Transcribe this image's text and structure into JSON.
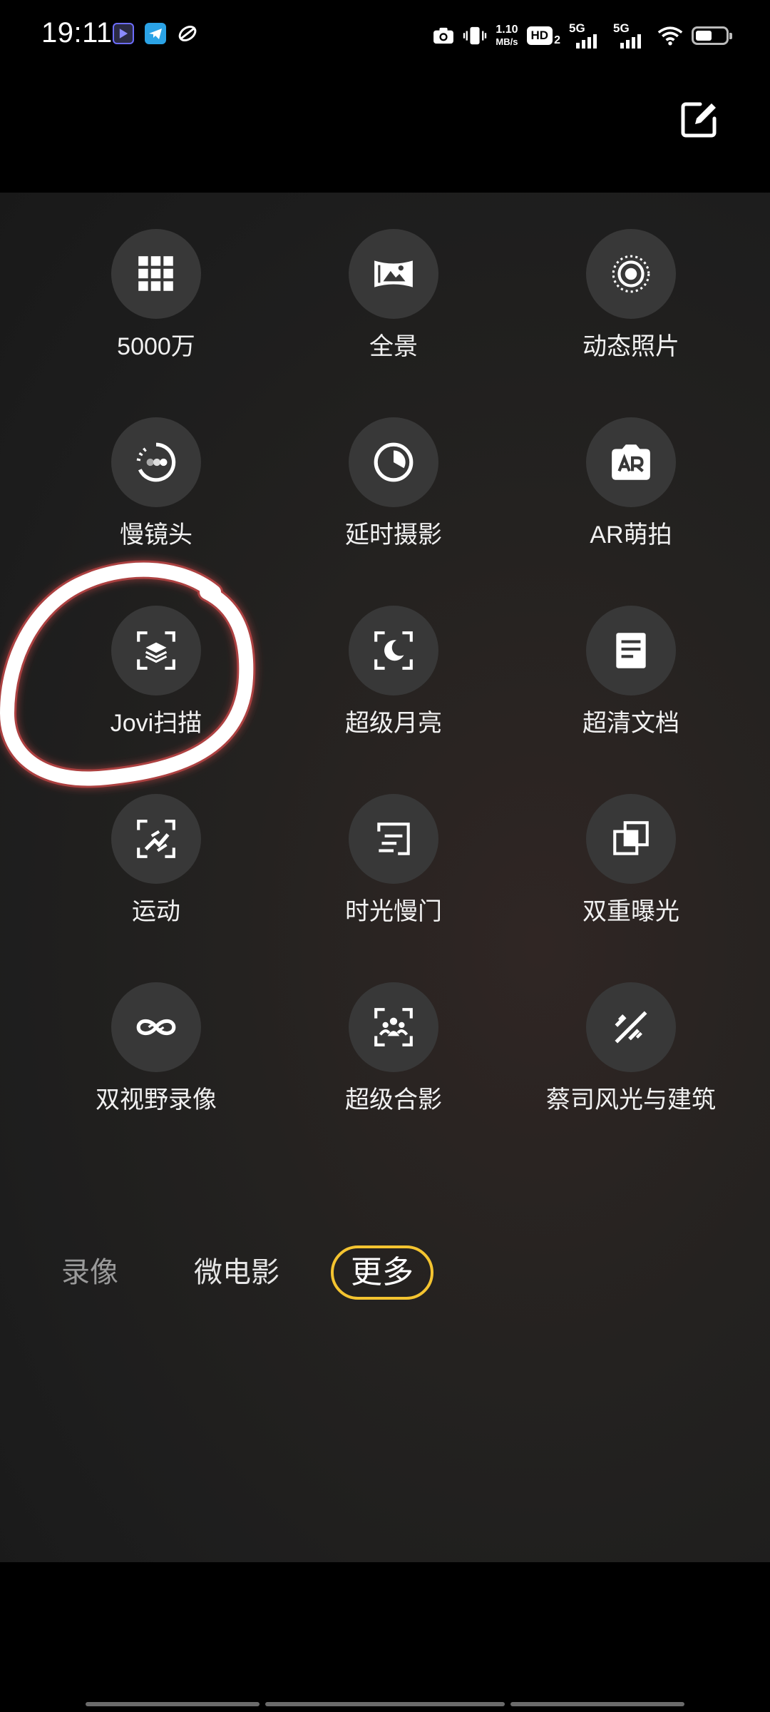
{
  "status_bar": {
    "time": "19:11",
    "speed_value": "1.10",
    "speed_unit": "MB/s",
    "hd_label": "HD",
    "hd_sub": "2",
    "sim1": "5G",
    "sim2": "5G",
    "battery_level": 0.55,
    "icons": [
      "app-notification-icon",
      "telegram-icon",
      "app-notification-icon",
      "camera-icon",
      "vibrate-icon",
      "wifi-icon",
      "battery-icon"
    ]
  },
  "header": {
    "edit_icon": "edit-icon"
  },
  "modes": [
    {
      "label": "5000万",
      "icon": "grid-icon"
    },
    {
      "label": "全景",
      "icon": "panorama-icon"
    },
    {
      "label": "动态照片",
      "icon": "live-photo-icon"
    },
    {
      "label": "慢镜头",
      "icon": "slow-motion-icon"
    },
    {
      "label": "延时摄影",
      "icon": "timelapse-icon"
    },
    {
      "label": "AR萌拍",
      "icon": "ar-icon"
    },
    {
      "label": "Jovi扫描",
      "icon": "scan-icon"
    },
    {
      "label": "超级月亮",
      "icon": "moon-icon"
    },
    {
      "label": "超清文档",
      "icon": "document-icon"
    },
    {
      "label": "运动",
      "icon": "sport-icon"
    },
    {
      "label": "时光慢门",
      "icon": "slow-shutter-icon"
    },
    {
      "label": "双重曝光",
      "icon": "double-exposure-icon"
    },
    {
      "label": "双视野录像",
      "icon": "dual-view-icon"
    },
    {
      "label": "超级合影",
      "icon": "group-photo-icon"
    },
    {
      "label": "蔡司风光与建筑",
      "icon": "landscape-icon"
    }
  ],
  "tabs": {
    "video": "录像",
    "micro_film": "微电影",
    "more": "更多",
    "active": "更多"
  },
  "annotation": {
    "target": "Jovi扫描",
    "color": "#ffffff"
  },
  "colors": {
    "accent": "#f4c430",
    "tile_bg": "#383838"
  }
}
